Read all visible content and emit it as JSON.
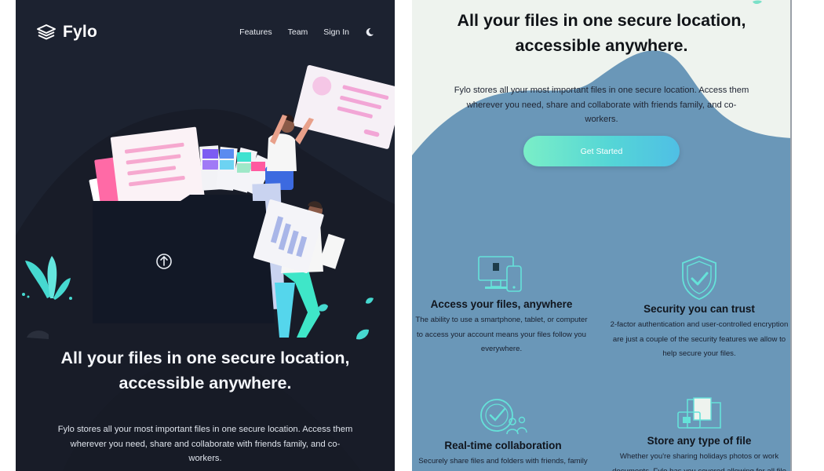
{
  "left_panel": {
    "logo": {
      "text": "Fylo",
      "icon": "stacked-layers-icon"
    },
    "nav": {
      "features": "Features",
      "team": "Team",
      "sign_in": "Sign In",
      "theme_icon": "moon-icon"
    },
    "hero": {
      "upload_icon": "upload-arrow-icon",
      "title_line1": "All your files in one secure location,",
      "title_line2": "accessible anywhere.",
      "description": "Fylo stores all your most important files in one secure location. Access them wherever you need, share and collaborate with friends family, and co-workers."
    },
    "colors": {
      "background": "#1c2230",
      "hill": "#181c28",
      "folder": "#141a26"
    }
  },
  "right_panel": {
    "hero": {
      "title_line1": "All your files in one secure location,",
      "title_line2": "accessible anywhere.",
      "description": "Fylo stores all your most important files in one secure location. Access them wherever you need, share and collaborate with friends family, and co-workers.",
      "cta_label": "Get Started"
    },
    "features": [
      {
        "icon": "devices-icon",
        "title": "Access your files, anywhere",
        "description": "The ability to use a smartphone, tablet, or computer to access your account means your files follow you everywhere."
      },
      {
        "icon": "shield-check-icon",
        "title": "Security you can trust",
        "description": "2-factor authentication and user-controlled encryption are just a couple of the security features we allow to help secure your files."
      },
      {
        "icon": "collaboration-icon",
        "title": "Real-time collaboration",
        "description": "Securely share files and folders with friends, family and colleagues for live collaboration. No email"
      },
      {
        "icon": "file-folder-icon",
        "title": "Store any type of file",
        "description": "Whether you're sharing holidays photos or work documents, Fylo has you covered allowing for all file"
      }
    ],
    "colors": {
      "wave_light": "#eef3ee",
      "wave_blue": "#6a97b8",
      "accent_cyan": "#65e2d9",
      "accent_blue": "#4fbfe5"
    }
  }
}
